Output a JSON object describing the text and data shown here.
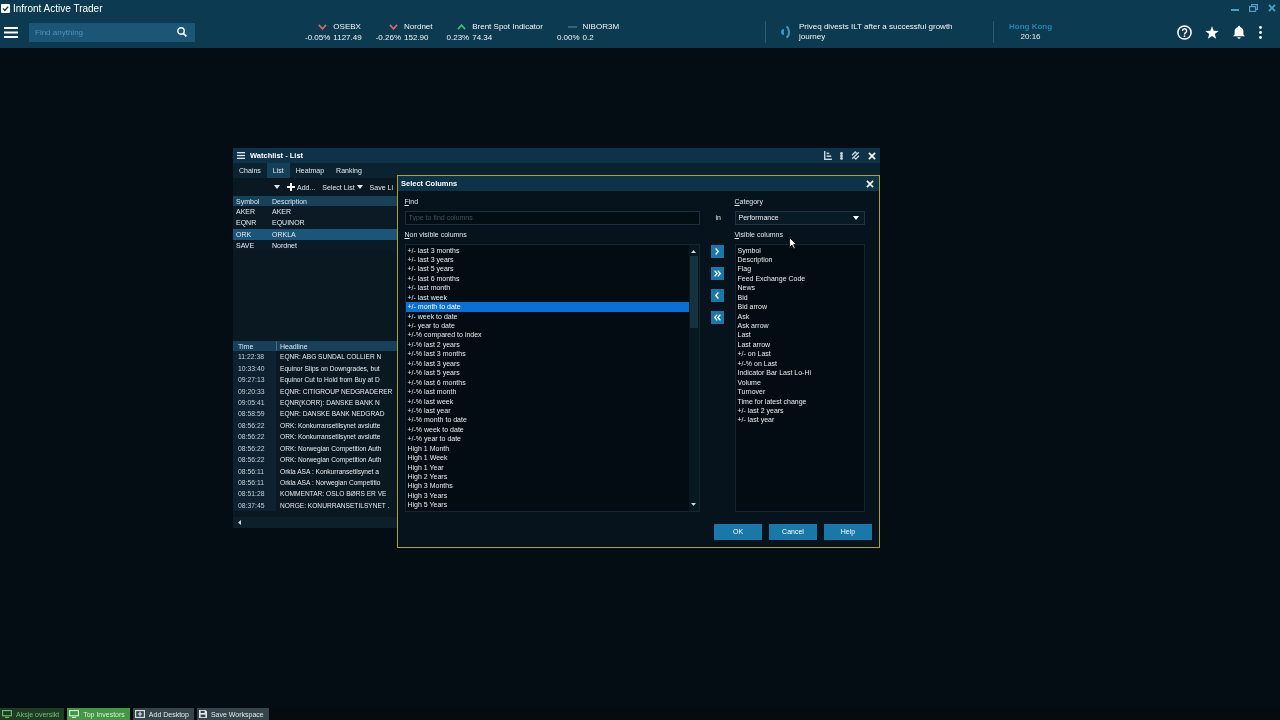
{
  "window": {
    "title": "Infront Active Trader"
  },
  "top_bar": {
    "search": {
      "placeholder": "Find anything"
    },
    "tickers": [
      {
        "name": "OSEBX",
        "change": "-0.05%",
        "value": "1127.49",
        "kind": "down"
      },
      {
        "name": "Nordnet",
        "change": "-0.26%",
        "value": "152.90",
        "kind": "down"
      },
      {
        "name": "Brent Spot Indicator",
        "change": "0.23%",
        "value": "74.34",
        "kind": "up"
      },
      {
        "name": "NIBOR3M",
        "change": "0.00%",
        "value": "0.2",
        "kind": "flat"
      }
    ],
    "news": {
      "headline": "Priveq divests ILT after a successful growth journey"
    },
    "clock": {
      "city": "Hong Kong",
      "time": "20:16"
    }
  },
  "watchlist": {
    "title": "Watchlist - List",
    "tabs": [
      {
        "label": "Chains",
        "selected": false
      },
      {
        "label": "List",
        "selected": true
      },
      {
        "label": "Heatmap",
        "selected": false
      },
      {
        "label": "Ranking",
        "selected": false
      }
    ],
    "toolbar": [
      {
        "label": "Add...",
        "kind": "add"
      },
      {
        "label": "Select List",
        "kind": "menu"
      },
      {
        "label": "Save Li",
        "kind": "plain"
      }
    ],
    "columns": [
      "Symbol",
      "Description"
    ],
    "rows": [
      {
        "symbol": "AKER",
        "description": "AKER",
        "selected": false
      },
      {
        "symbol": "EQNR",
        "description": "EQUINOR",
        "selected": false
      },
      {
        "symbol": "ORK",
        "description": "ORKLA",
        "selected": true
      },
      {
        "symbol": "SAVE",
        "description": "Nordnet",
        "selected": false
      }
    ],
    "news_columns": [
      "Time",
      "Headline"
    ],
    "news_rows": [
      {
        "time": "11:22:38",
        "headline": "EQNR: ABG SUNDAL COLLIER N"
      },
      {
        "time": "10:33:40",
        "headline": "Equinor Slips on Downgrades, but"
      },
      {
        "time": "09:27:13",
        "headline": "Equinor Cut to Hold from Buy at D"
      },
      {
        "time": "09:20:33",
        "headline": "EQNR: CITIGROUP NEDGRADERER"
      },
      {
        "time": "09:05:41",
        "headline": "EQNR(KORR): DANSKE BANK N"
      },
      {
        "time": "08:58:59",
        "headline": "EQNR: DANSKE BANK NEDGRAD"
      },
      {
        "time": "08:56:22",
        "headline": "ORK: Konkurransetilsynet avslutte"
      },
      {
        "time": "08:56:22",
        "headline": "ORK: Konkurransetilsynet avslutte"
      },
      {
        "time": "08:56:22",
        "headline": "ORK: Norwegian Competition Auth"
      },
      {
        "time": "08:56:22",
        "headline": "ORK: Norwegian Competition Auth"
      },
      {
        "time": "08:56:11",
        "headline": "Orkla ASA : Konkurransetilsynet a"
      },
      {
        "time": "08:56:11",
        "headline": "Orkla ASA : Norwegian Competitio"
      },
      {
        "time": "08:51:28",
        "headline": "KOMMENTAR: OSLO BØRS ER VE"
      },
      {
        "time": "08:37:45",
        "headline": "NORGE: KONURRANSETILSYNET ."
      }
    ]
  },
  "dialog": {
    "title": "Select Columns",
    "find_label": "Find",
    "find_placeholder": "Type to find columns",
    "in_label": "in",
    "category_label": "Category",
    "category_value": "Performance",
    "non_visible_label": "Non visible columns",
    "visible_label": "Visible columns",
    "non_visible_columns": [
      {
        "label": "+/- last 3 months",
        "selected": false
      },
      {
        "label": "+/- last 3 years",
        "selected": false
      },
      {
        "label": "+/- last 5 years",
        "selected": false
      },
      {
        "label": "+/- last 6 months",
        "selected": false
      },
      {
        "label": "+/- last month",
        "selected": false
      },
      {
        "label": "+/- last week",
        "selected": false
      },
      {
        "label": "+/- month to date",
        "selected": true
      },
      {
        "label": "+/- week to date",
        "selected": false
      },
      {
        "label": "+/- year to date",
        "selected": false
      },
      {
        "label": "+/-% compared to index",
        "selected": false
      },
      {
        "label": "+/-% last 2 years",
        "selected": false
      },
      {
        "label": "+/-% last 3 months",
        "selected": false
      },
      {
        "label": "+/-% last 3 years",
        "selected": false
      },
      {
        "label": "+/-% last 5 years",
        "selected": false
      },
      {
        "label": "+/-% last 6 months",
        "selected": false
      },
      {
        "label": "+/-% last month",
        "selected": false
      },
      {
        "label": "+/-% last week",
        "selected": false
      },
      {
        "label": "+/-% last year",
        "selected": false
      },
      {
        "label": "+/-% month to date",
        "selected": false
      },
      {
        "label": "+/-% week to date",
        "selected": false
      },
      {
        "label": "+/-% year to date",
        "selected": false
      },
      {
        "label": "High 1 Month",
        "selected": false
      },
      {
        "label": "High 1 Week",
        "selected": false
      },
      {
        "label": "High 1 Year",
        "selected": false
      },
      {
        "label": "High 2 Years",
        "selected": false
      },
      {
        "label": "High 3 Months",
        "selected": false
      },
      {
        "label": "High 3 Years",
        "selected": false
      },
      {
        "label": "High 5 Years",
        "selected": false
      }
    ],
    "visible_columns": [
      "Symbol",
      "Description",
      "Flag",
      "Feed Exchange Code",
      "News",
      "Bid",
      "Bid arrow",
      "Ask",
      "Ask arrow",
      "Last",
      "Last arrow",
      "+/- on Last",
      "+/-% on Last",
      "Indicator Bar Last Lo-Hi",
      "Volume",
      "Turnover",
      "Time for latest change",
      "+/- last 2 years",
      "+/- last year"
    ],
    "buttons": [
      "OK",
      "Cancel",
      "Help"
    ]
  },
  "taskbar": {
    "desktops": [
      {
        "label": "Aksje oversikt",
        "selected": false
      },
      {
        "label": "Top Investors",
        "selected": true
      }
    ],
    "actions": [
      {
        "label": "Add Desktop",
        "kind": "add"
      },
      {
        "label": "Save Workspace",
        "kind": "save"
      }
    ]
  }
}
